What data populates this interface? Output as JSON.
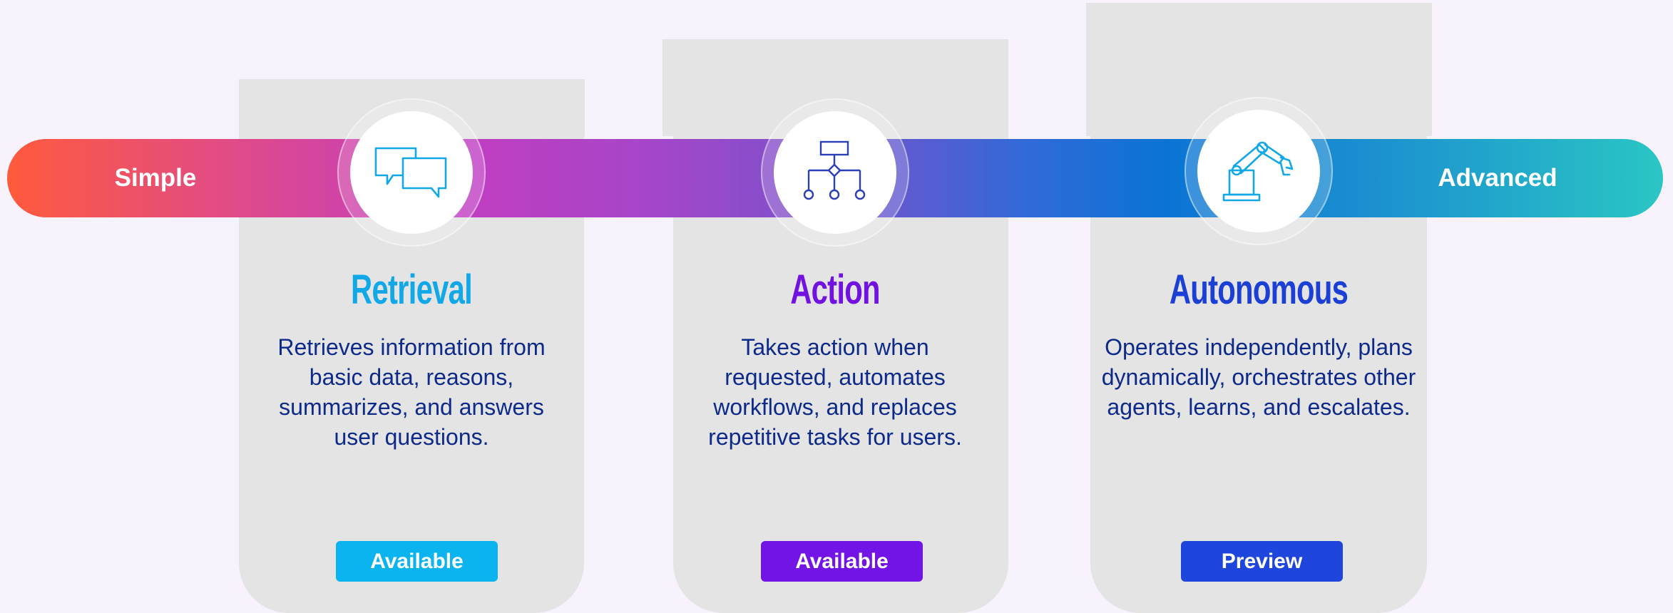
{
  "scale": {
    "start_label": "Simple",
    "end_label": "Advanced"
  },
  "stages": [
    {
      "title": "Retrieval",
      "description": "Retrieves information from basic data, reasons, summarizes, and answers user questions.",
      "badge": "Available",
      "icon": "chat-bubbles-icon",
      "title_color": "#12a8e8",
      "badge_color": "#0bb4ef"
    },
    {
      "title": "Action",
      "description": "Takes action when requested, automates workflows, and replaces repetitive tasks for users.",
      "badge": "Available",
      "icon": "workflow-diagram-icon",
      "title_color": "#7212e0",
      "badge_color": "#7214e6"
    },
    {
      "title": "Autonomous",
      "description": "Operates independently, plans dynamically, orchestrates other agents, learns, and escalates.",
      "badge": "Preview",
      "icon": "robot-arm-icon",
      "title_color": "#1c3fd6",
      "badge_color": "#1e45dc"
    }
  ]
}
